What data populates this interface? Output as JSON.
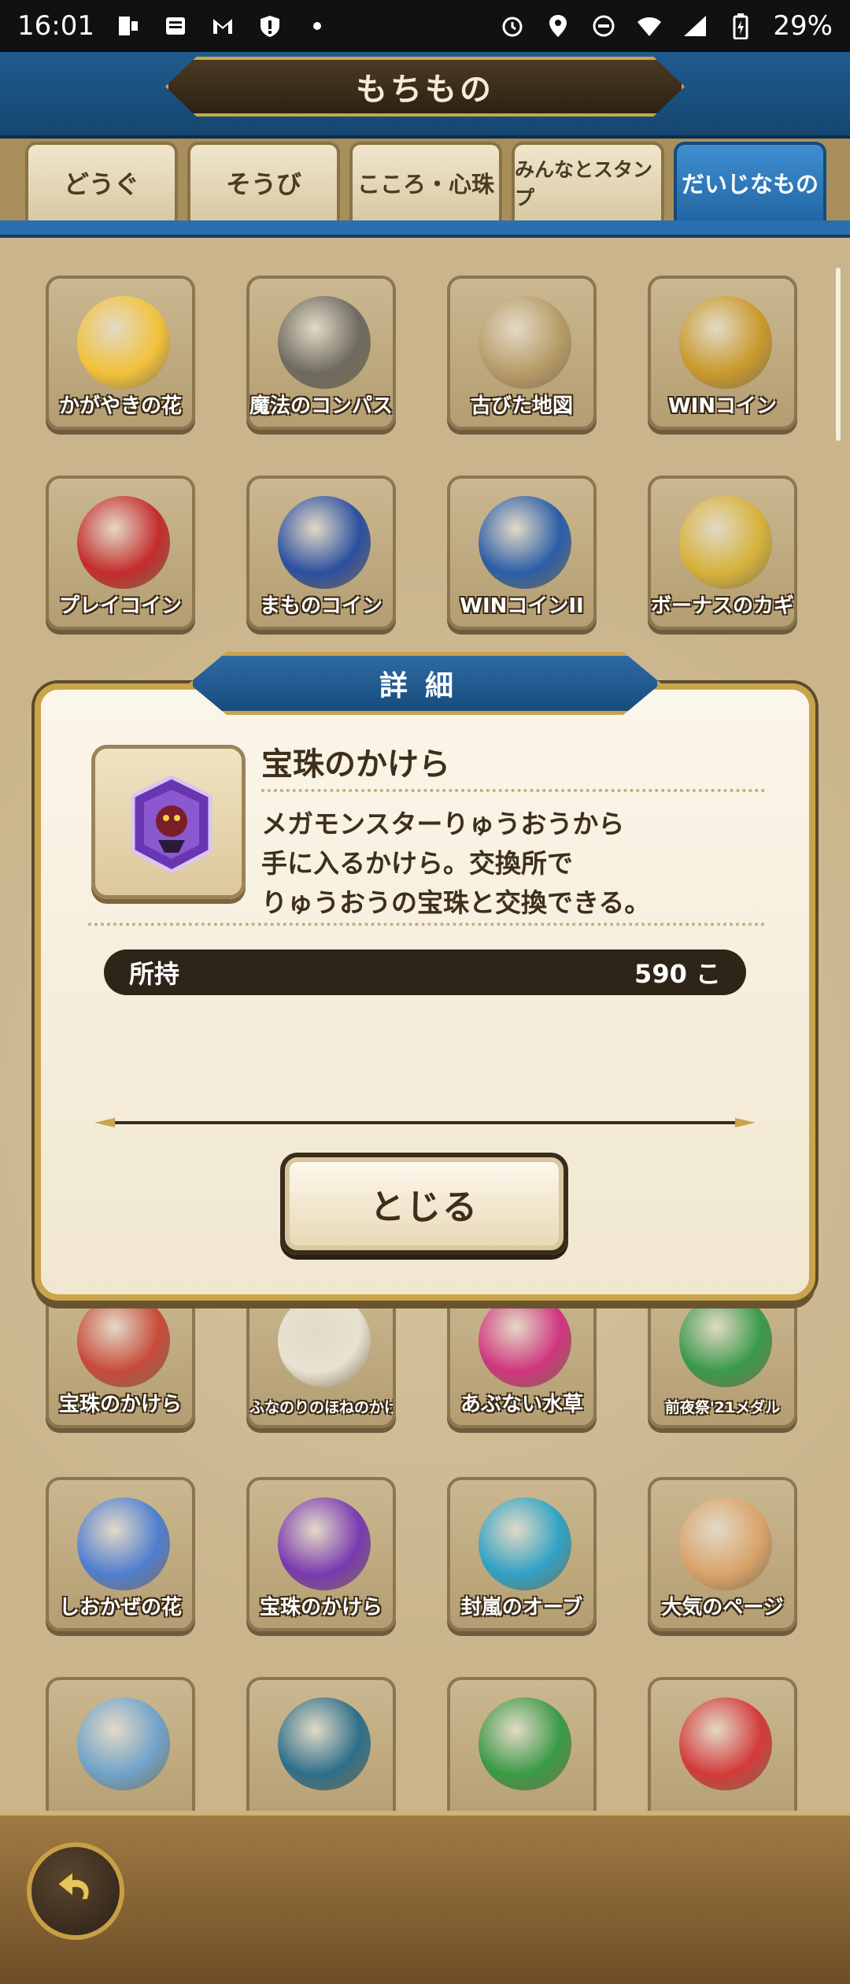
{
  "status_bar": {
    "time": "16:01",
    "battery": "29%",
    "icons": [
      "notification-icon",
      "news-icon",
      "gmail-icon",
      "alert-icon",
      "alarm-icon",
      "location-icon",
      "dnd-icon",
      "wifi-icon",
      "signal-icon",
      "battery-icon"
    ]
  },
  "header": {
    "title": "もちもの"
  },
  "tabs": [
    {
      "label": "どうぐ",
      "active": false
    },
    {
      "label": "そうび",
      "active": false
    },
    {
      "label": "こころ・心珠",
      "active": false
    },
    {
      "label": "みんなとスタンプ",
      "active": false
    },
    {
      "label": "だいじなもの",
      "active": true
    }
  ],
  "grid": {
    "rows": [
      [
        {
          "label": "かがやきの花",
          "icon": "yellow-flower-icon",
          "color": "#f2c23a"
        },
        {
          "label": "魔法のコンパス",
          "icon": "compass-icon",
          "color": "#6e6a60"
        },
        {
          "label": "古びた地図",
          "icon": "map-scroll-icon",
          "color": "#b79c68"
        },
        {
          "label": "WINコイン",
          "icon": "win-coin-icon",
          "color": "#c99a2c"
        }
      ],
      [
        {
          "label": "プレイコイン",
          "icon": "play-coin-icon",
          "color": "#c42c2c"
        },
        {
          "label": "まものコイン",
          "icon": "monster-coin-icon",
          "color": "#2b4fa0"
        },
        {
          "label": "WINコインII",
          "icon": "win-coin-2-icon",
          "color": "#2a5ea8"
        },
        {
          "label": "ボーナスのカギ",
          "icon": "key-icon",
          "color": "#d6b23a"
        }
      ],
      [
        {
          "label": "宝珠のかけら",
          "icon": "gem-fragment-icon",
          "color": "#c84a3a"
        },
        {
          "label": "ふなのりのほねのかけら",
          "icon": "bone-icon",
          "color": "#e8e2d2"
        },
        {
          "label": "あぶない水草",
          "icon": "heart-plant-icon",
          "color": "#d0357e"
        },
        {
          "label": "前夜祭'21メダル",
          "icon": "sneaker-medal-icon",
          "color": "#3a9a4a"
        }
      ],
      [
        {
          "label": "しおかぜの花",
          "icon": "blue-flower-icon",
          "color": "#4f7ed0"
        },
        {
          "label": "宝珠のかけら",
          "icon": "gem-fragment-icon",
          "color": "#7a3ab0"
        },
        {
          "label": "封嵐のオーブ",
          "icon": "orb-icon",
          "color": "#2fa2c4"
        },
        {
          "label": "大気のページ",
          "icon": "page-scroll-icon",
          "color": "#d9a36a"
        }
      ],
      [
        {
          "label": "",
          "icon": "bag-icon",
          "color": "#6fa3c9"
        },
        {
          "label": "",
          "icon": "roman-six-medal-icon",
          "color": "#2d6f8a"
        },
        {
          "label": "",
          "icon": "green-gem-icon",
          "color": "#3a9a46"
        },
        {
          "label": "",
          "icon": "red-card-icon",
          "color": "#d43a3a"
        }
      ]
    ]
  },
  "modal": {
    "title": "詳細",
    "item_name": "宝珠のかけら",
    "item_icon": "purple-gem-fragment-icon",
    "description_lines": [
      "メガモンスターりゅうおうから",
      "手に入るかけら。交換所で",
      "りゅうおうの宝珠と交換できる。"
    ],
    "owned_label": "所持",
    "owned_value": "590 こ",
    "close_label": "とじる"
  },
  "colors": {
    "header_blue": "#1f5c8f",
    "gold": "#c8a44c",
    "panel": "#fbf6ea",
    "text_brown": "#3e2f1a"
  }
}
